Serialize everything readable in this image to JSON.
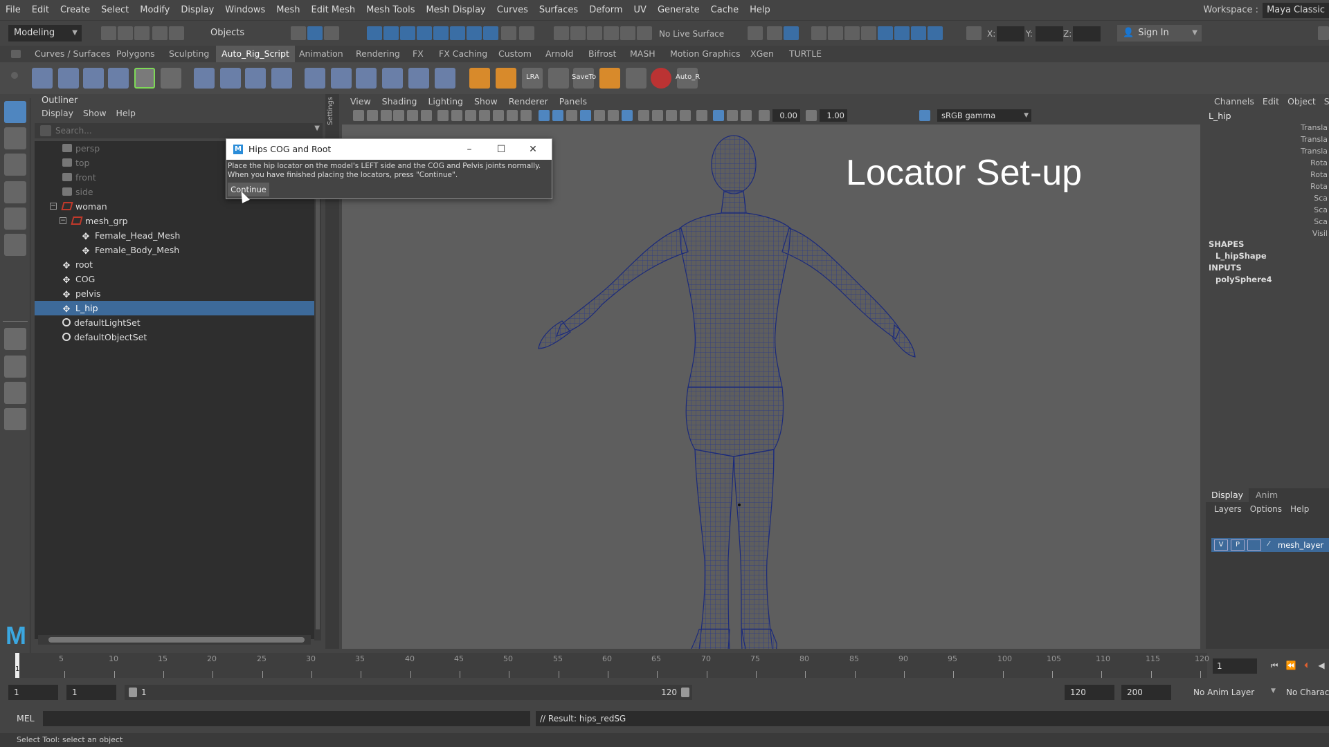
{
  "menubar": {
    "items": [
      "File",
      "Edit",
      "Create",
      "Select",
      "Modify",
      "Display",
      "Windows",
      "Mesh",
      "Edit Mesh",
      "Mesh Tools",
      "Mesh Display",
      "Curves",
      "Surfaces",
      "Deform",
      "UV",
      "Generate",
      "Cache",
      "Help"
    ],
    "workspace_label": "Workspace :",
    "workspace_value": "Maya Classic"
  },
  "statusline": {
    "menuset": "Modeling",
    "objects_dropdown": "Objects",
    "live_surface": "No Live Surface",
    "x_label": "X:",
    "y_label": "Y:",
    "z_label": "Z:",
    "sign_in": "Sign In"
  },
  "shelf": {
    "tabs": [
      "Curves / Surfaces",
      "Polygons",
      "Sculpting",
      "Auto_Rig_Script",
      "Animation",
      "Rendering",
      "FX",
      "FX Caching",
      "Custom",
      "Arnold",
      "Bifrost",
      "MASH",
      "Motion Graphics",
      "XGen",
      "TURTLE"
    ],
    "active_tab": "Auto_Rig_Script",
    "icon_labels": {
      "lra": "LRA",
      "saveto": "SaveTo",
      "autor": "Auto_R"
    }
  },
  "outliner": {
    "title": "Outliner",
    "menu": [
      "Display",
      "Show",
      "Help"
    ],
    "search_placeholder": "Search...",
    "nodes": [
      "persp",
      "top",
      "front",
      "side",
      "woman",
      "mesh_grp",
      "Female_Head_Mesh",
      "Female_Body_Mesh",
      "root",
      "COG",
      "pelvis",
      "L_hip",
      "defaultLightSet",
      "defaultObjectSet"
    ],
    "selected": "L_hip"
  },
  "dialog": {
    "title": "Hips COG and Root",
    "message_line1": "Place the hip locator on the model's LEFT side and the COG and Pelvis joints normally.",
    "message_line2": "When you have finished placing the locators, press \"Continue\".",
    "continue_label": "Continue",
    "minimize": "–",
    "maximize": "☐",
    "close": "✕"
  },
  "panel_gutter_label": "Settings",
  "viewport": {
    "menu": [
      "View",
      "Shading",
      "Lighting",
      "Show",
      "Renderer",
      "Panels"
    ],
    "exposure": "0.00",
    "gamma": "1.00",
    "color_space": "sRGB gamma",
    "overlay_title": "Locator Set-up"
  },
  "channelbox": {
    "menu": [
      "Channels",
      "Edit",
      "Object",
      "Sh"
    ],
    "object_name": "L_hip",
    "attrs": [
      "Transla",
      "Transla",
      "Transla",
      "Rota",
      "Rota",
      "Rota",
      "Sca",
      "Sca",
      "Sca",
      "Visil"
    ],
    "shapes_header": "SHAPES",
    "shape_name": "L_hipShape",
    "inputs_header": "INPUTS",
    "input_name": "polySphere4"
  },
  "layers": {
    "tabs": [
      "Display",
      "Anim"
    ],
    "active_tab": "Display",
    "menu": [
      "Layers",
      "Options",
      "Help"
    ],
    "layer_v": "V",
    "layer_p": "P",
    "layer_name": "mesh_layer"
  },
  "timeslider": {
    "ticks": [
      "5",
      "10",
      "15",
      "20",
      "25",
      "30",
      "35",
      "40",
      "45",
      "50",
      "55",
      "60",
      "65",
      "70",
      "75",
      "80",
      "85",
      "90",
      "95",
      "100",
      "105",
      "110",
      "115",
      "120"
    ],
    "current_marker": "1",
    "current_frame": "1"
  },
  "range": {
    "start": "1",
    "playback_start": "1",
    "bar_start": "1",
    "bar_end": "120",
    "playback_end": "120",
    "end": "200",
    "anim_layer": "No Anim Layer",
    "character": "No Character Set"
  },
  "cmdline": {
    "mel_label": "MEL",
    "result": "// Result: hips_redSG"
  },
  "helpline": "Select Tool: select an object"
}
